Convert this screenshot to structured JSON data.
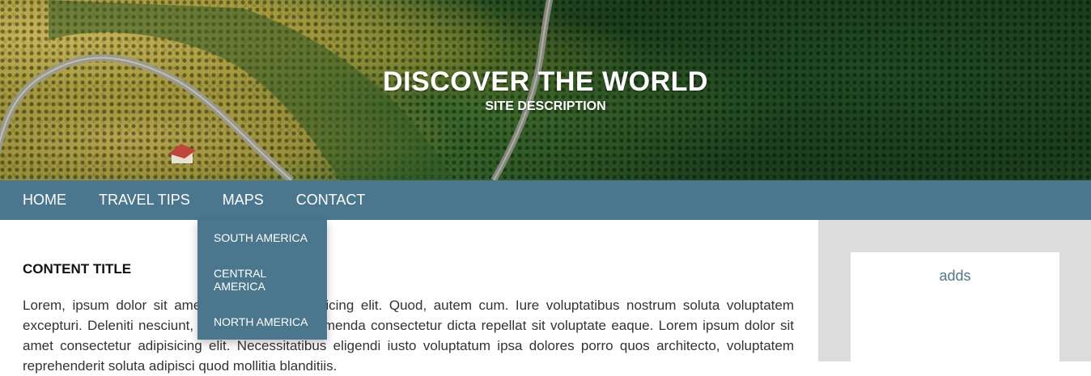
{
  "header": {
    "title": "DISCOVER THE WORLD",
    "description": "SITE DESCRIPTION"
  },
  "nav": {
    "items": [
      {
        "label": "HOME"
      },
      {
        "label": "TRAVEL TIPS"
      },
      {
        "label": "MAPS"
      },
      {
        "label": "CONTACT"
      }
    ],
    "dropdown": [
      {
        "label": "SOUTH AMERICA"
      },
      {
        "label": "CENTRAL AMERICA"
      },
      {
        "label": "NORTH AMERICA"
      }
    ]
  },
  "content": {
    "title": "CONTENT TITLE",
    "body": "Lorem, ipsum dolor sit amet consectetur adipisicing elit. Quod, autem cum. Iure voluptatibus nostrum soluta voluptatem excepturi. Deleniti nesciunt, quia quisquam assumenda consectetur dicta repellat sit voluptate eaque. Lorem ipsum dolor sit amet consectetur adipisicing elit. Necessitatibus eligendi iusto voluptatum ipsa dolores porro quos architecto, voluptatem reprehenderit soluta adipisci quod mollitia blanditiis."
  },
  "sidebar": {
    "ad_label": "adds"
  },
  "colors": {
    "nav_bg": "#4a778d",
    "sidebar_bg": "#dcdcdc",
    "accent_text": "#4a778d"
  }
}
